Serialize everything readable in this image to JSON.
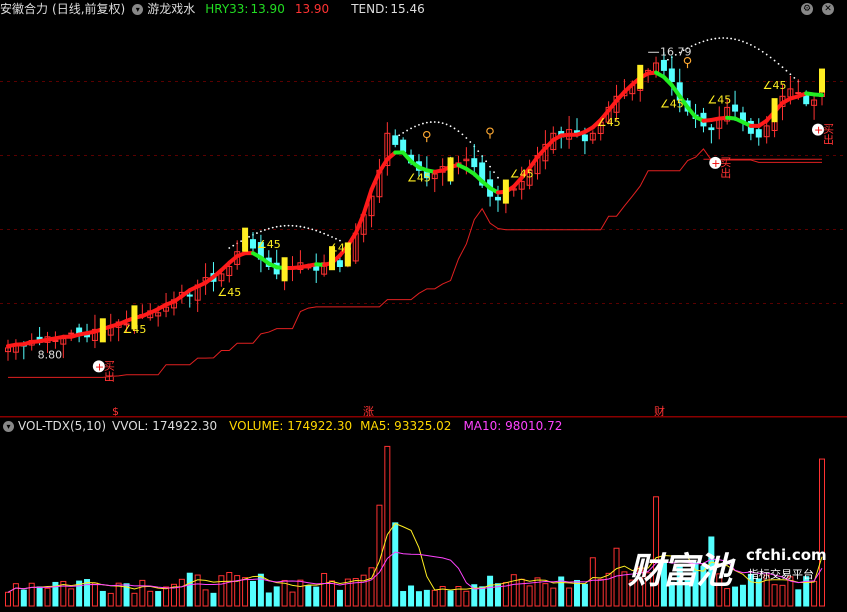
{
  "header": {
    "stock": "安徽合力",
    "period": "(日线,前复权)",
    "indicator": "游龙戏水",
    "hry_label": "HRY33:",
    "hry_value": "13.90",
    "hry_value2": "13.90",
    "tend_label": "TEND:",
    "tend_value": "15.46"
  },
  "vol_header": {
    "name": "VOL-TDX(5,10)",
    "vvol": "VVOL: 174922.30",
    "volume": "VOLUME: 174922.30",
    "ma5": "MA5: 93325.02",
    "ma10": "MA10: 98010.72"
  },
  "annotations": {
    "high": "16.79",
    "low": "8.80",
    "angle": "∠45",
    "sell": "卖出",
    "buy": "买",
    "marker_s": "$",
    "marker_zhang": "涨",
    "marker_cai": "财"
  },
  "icons": {
    "dropdown": "dropdown-circle-icon",
    "settings": "gear-icon",
    "close": "close-icon"
  },
  "watermark": {
    "brand": "财富池",
    "site": "cfchi.com",
    "tagline": "指标交易平台"
  },
  "chart_data": {
    "type": "candlestick",
    "price": {
      "ylim": [
        7.5,
        17.5
      ],
      "closes": [
        8.8,
        8.9,
        8.85,
        9.0,
        8.95,
        9.1,
        9.0,
        9.05,
        9.2,
        9.15,
        9.1,
        9.3,
        9.25,
        9.4,
        9.5,
        9.45,
        9.6,
        9.7,
        9.8,
        9.75,
        9.9,
        10.1,
        10.3,
        10.2,
        10.5,
        10.7,
        10.6,
        10.8,
        11.0,
        11.4,
        11.7,
        11.5,
        11.2,
        11.0,
        10.8,
        10.9,
        11.0,
        11.1,
        11.0,
        10.9,
        11.1,
        11.2,
        11.0,
        11.3,
        11.9,
        12.4,
        12.9,
        13.6,
        14.6,
        14.3,
        14.1,
        13.8,
        13.6,
        13.4,
        13.5,
        13.7,
        13.6,
        13.8,
        13.9,
        13.7,
        13.2,
        12.9,
        12.8,
        13.0,
        13.1,
        13.3,
        13.6,
        14.0,
        14.3,
        14.6,
        14.5,
        14.7,
        14.6,
        14.4,
        14.6,
        14.9,
        15.3,
        15.6,
        15.7,
        15.9,
        16.1,
        16.3,
        16.5,
        16.3,
        16.0,
        15.5,
        15.2,
        15.0,
        14.8,
        14.7,
        15.0,
        15.3,
        15.2,
        14.9,
        14.6,
        14.5,
        14.8,
        15.2,
        15.6,
        15.8,
        15.7,
        15.4,
        15.5,
        16.0
      ]
    },
    "volume": {
      "ylim": [
        0,
        200000
      ],
      "last": 174922.3,
      "ma5": 93325.02,
      "ma10": 98010.72
    }
  }
}
